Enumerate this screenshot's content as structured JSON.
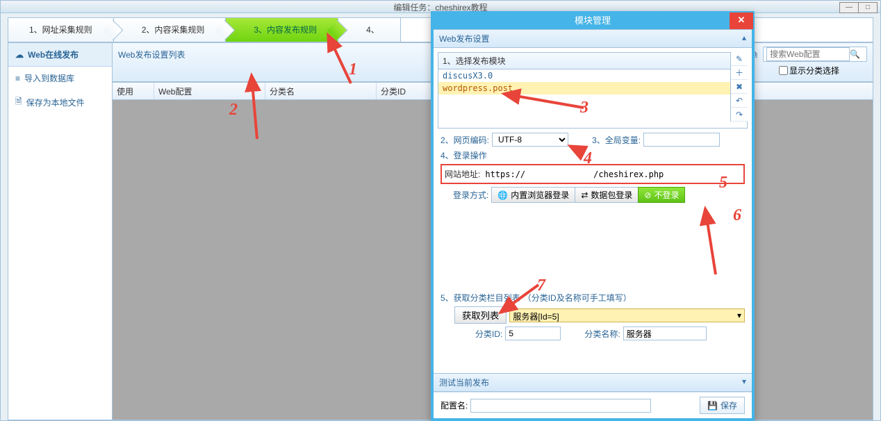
{
  "window_title": "编辑任务：cheshirex教程",
  "steps": {
    "s1": "1、网址采集规则",
    "s2": "2、内容采集规则",
    "s3": "3、内容发布规则",
    "s4": "4、"
  },
  "left_nav": {
    "web_publish": "Web在线发布",
    "import_db": "导入到数据库",
    "save_local": "保存为本地文件"
  },
  "main": {
    "list_title": "Web发布设置列表",
    "search_placeholder": "搜索Web配置",
    "show_category": "显示分类选择",
    "cols": {
      "use": "使用",
      "cfg": "Web配置",
      "catname": "分类名",
      "catid": "分类ID"
    }
  },
  "modal": {
    "title": "模块管理",
    "section_web": "Web发布设置",
    "mod_head": "1、选择发布模块",
    "mod1": "discusX3.0",
    "mod2": "wordpress.post",
    "enc_label": "2、网页编码:",
    "enc_value": "UTF-8",
    "global_label": "3、全局变量:",
    "login_op": "4、登录操作",
    "url_label": "网站地址:",
    "url_prefix": "https://",
    "url_suffix": "/cheshirex.php",
    "login_mode": "登录方式:",
    "login_browser": "内置浏览器登录",
    "login_packet": "数据包登录",
    "login_none": "不登录",
    "cat_section": "5、获取分类栏目列表",
    "cat_hint": "（分类ID及名称可手工填写）",
    "get_list": "获取列表",
    "server_sel": "服务器[Id=5]",
    "cat_id_label": "分类ID:",
    "cat_id_val": "5",
    "cat_name_label": "分类名称:",
    "cat_name_val": "服务器",
    "test_pub": "测试当前发布",
    "cfg_name": "配置名:",
    "save": "保存"
  },
  "annotations": {
    "n1": "1",
    "n2": "2",
    "n3": "3",
    "n4": "4",
    "n5": "5",
    "n6": "6",
    "n7": "7"
  }
}
